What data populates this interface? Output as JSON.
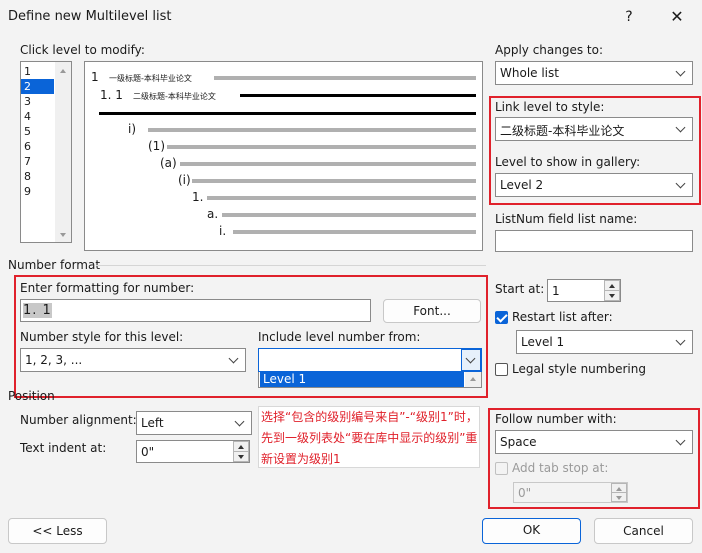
{
  "window": {
    "title": "Define new Multilevel list",
    "help": "?",
    "close": "✕"
  },
  "levels": {
    "label": "Click level to modify:",
    "items": [
      "1",
      "2",
      "3",
      "4",
      "5",
      "6",
      "7",
      "8",
      "9"
    ],
    "selected": "2"
  },
  "preview": {
    "lines": [
      "1",
      "一级标题-本科毕业论文",
      "1. 1",
      "二级标题-本科毕业论文",
      "i)",
      "(1)",
      "(a)",
      "(i)",
      "1.",
      "a.",
      "i."
    ]
  },
  "apply": {
    "label": "Apply changes to:",
    "value": "Whole list"
  },
  "link": {
    "label": "Link level to style:",
    "value": "二级标题-本科毕业论文"
  },
  "gallery": {
    "label": "Level to show in gallery:",
    "value": "Level 2"
  },
  "listnum": {
    "label": "ListNum field list name:",
    "value": ""
  },
  "number_format": {
    "section": "Number format",
    "enter_label": "Enter formatting for number:",
    "format_value": "1. 1",
    "font_button": "Font...",
    "style_label": "Number style for this level:",
    "style_value": "1, 2, 3, ...",
    "include_label": "Include level number from:",
    "include_value": "",
    "include_options": [
      "Level 1"
    ]
  },
  "start": {
    "label": "Start at:",
    "value": "1"
  },
  "restart": {
    "label": "Restart list after:",
    "checked": true,
    "value": "Level 1"
  },
  "legal": {
    "label": "Legal style numbering",
    "checked": false
  },
  "position": {
    "section": "Position",
    "alignment_label": "Number alignment:",
    "alignment_value": "Left",
    "indent_label": "Text indent at:",
    "indent_value": "0\""
  },
  "follow": {
    "label": "Follow number with:",
    "value": "Space",
    "tab_label": "Add tab stop at:",
    "tab_value": "0\""
  },
  "annotation": {
    "text": "选择“包含的级别编号来自”-“级别1”时，先到一级列表处“要在库中显示的级别”重新设置为级别1"
  },
  "buttons": {
    "less": "<< Less",
    "ok": "OK",
    "cancel": "Cancel"
  },
  "colors": {
    "accent": "#0a64d8",
    "highlight": "#e0212b"
  }
}
